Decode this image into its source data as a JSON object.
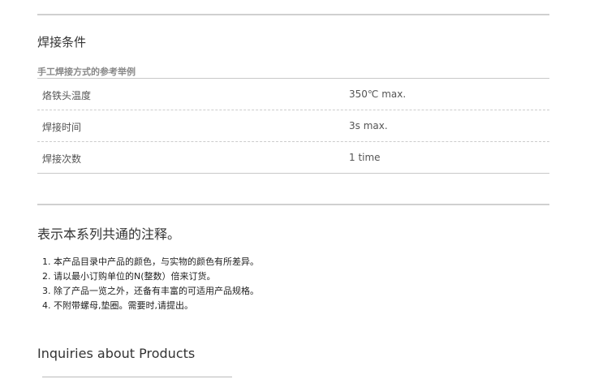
{
  "soldering": {
    "title": "焊接条件",
    "subtitle": "手工焊接方式的参考举例",
    "rows": [
      {
        "label": "烙铁头温度",
        "value": "350℃ max."
      },
      {
        "label": "焊接时间",
        "value": "3s max."
      },
      {
        "label": "焊接次数",
        "value": "1 time"
      }
    ]
  },
  "common_notes": {
    "title": "表示本系列共通的注释。",
    "items": [
      "1. 本产品目录中产品的颜色，与实物的颜色有所差异。",
      "2. 请以最小订购单位的N(整数）倍来订货。",
      "3. 除了产品一览之外，还备有丰富的可适用产品规格。",
      "4. 不附带螺母,垫圈。需要时,请提出。"
    ]
  },
  "inquiries": {
    "title": "Inquiries about Products"
  }
}
